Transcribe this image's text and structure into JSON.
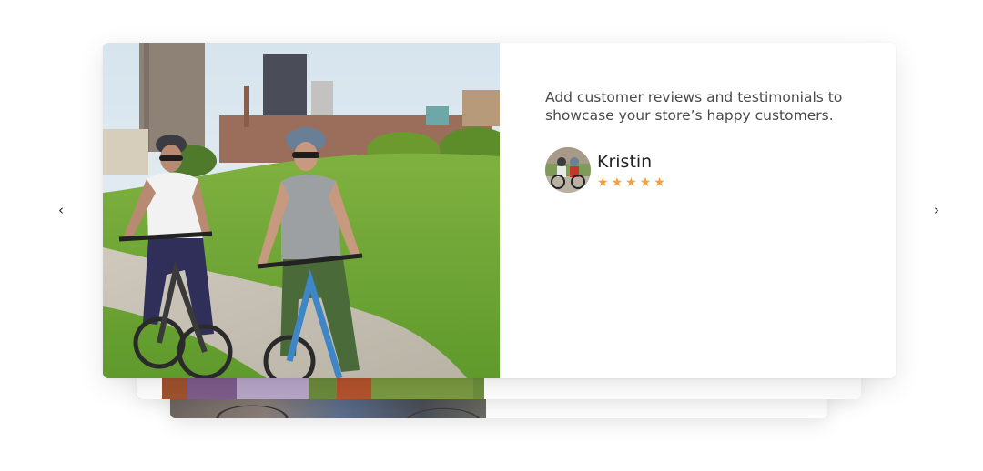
{
  "testimonial": {
    "quote_line1": "Add customer reviews and testimonials to",
    "quote_line2": "showcase your store’s happy customers.",
    "author_name": "Kristin",
    "rating": 5,
    "rating_max": 5,
    "star_glyph": "★",
    "star_color": "#f5a13b"
  },
  "navigation": {
    "prev_glyph": "‹",
    "next_glyph": "›"
  }
}
